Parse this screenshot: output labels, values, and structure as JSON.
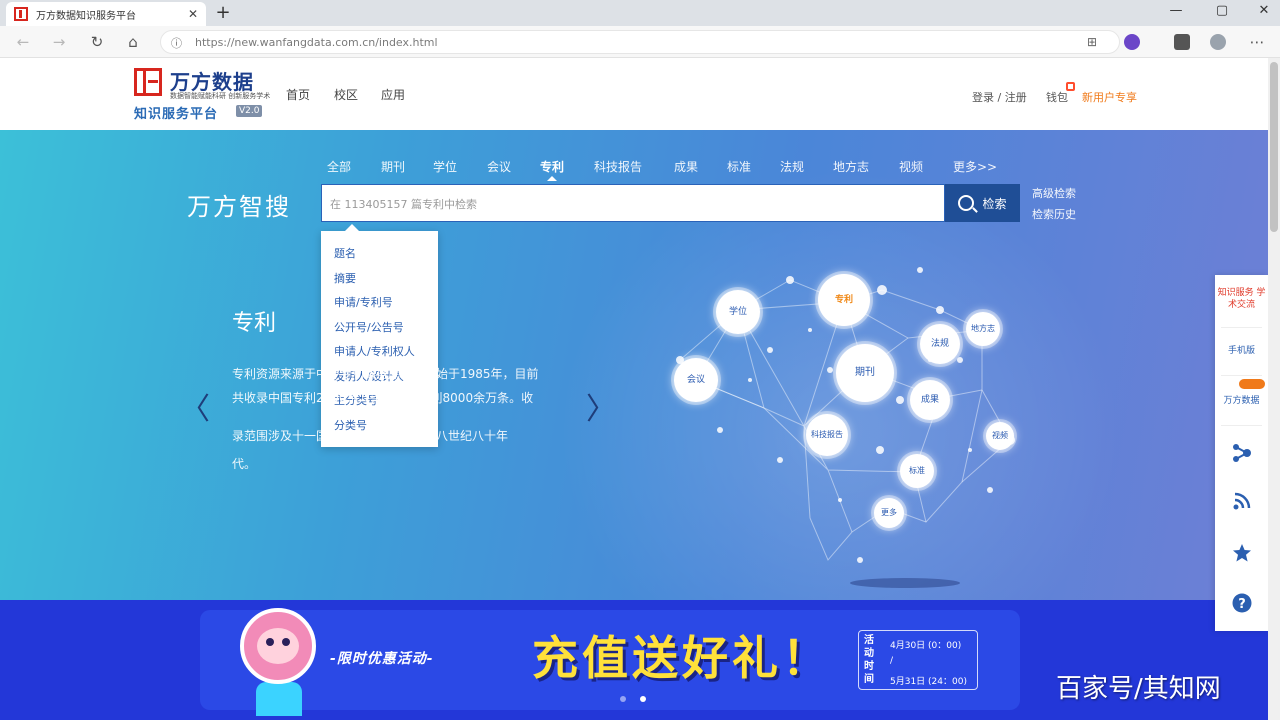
{
  "browser": {
    "tab_title": "万方数据知识服务平台",
    "tab_close": "✕",
    "new_tab": "+",
    "url": "https://new.wanfangdata.com.cn/index.html",
    "controls": {
      "minimize": "—",
      "maximize": "▢",
      "close": "✕"
    }
  },
  "header": {
    "logo_name": "万方数据",
    "logo_tagline": "数据智能赋能科研 创新服务学术",
    "logo_subtitle": "知识服务平台",
    "logo_version": "V2.0",
    "nav": [
      "首页",
      "校区",
      "应用"
    ],
    "login": "登录 / 注册",
    "cart": "钱包",
    "new_user": "新用户专享"
  },
  "search": {
    "categories": [
      "全部",
      "期刊",
      "学位",
      "会议",
      "专利",
      "科技报告",
      "成果",
      "标准",
      "法规",
      "地方志",
      "视频",
      "更多>>"
    ],
    "active_category": "专利",
    "brand": "万方智搜",
    "placeholder": "在 113405157 篇专利中检索",
    "button_label": "检索",
    "advanced": "高级检索",
    "history": "检索历史",
    "dropdown": [
      "题名",
      "摘要",
      "申请/专利号",
      "公开号/公告号",
      "申请人/专利权人",
      "发明人/设计人",
      "主分类号",
      "分类号"
    ]
  },
  "feature": {
    "title": "专利",
    "description_lines": [
      "专利资源来源于中外专利数据库，收录始于1985年，目前",
      "共收录中国专利2200余万条，国外专利8000余万条。收",
      "录范围涉及十一国两组织，内容涵盖十八世纪八十年",
      "代。"
    ],
    "prev": "〈",
    "next": "〉"
  },
  "brain_nodes": [
    "学位",
    "专利",
    "会议",
    "期刊",
    "法规",
    "地方志",
    "成果",
    "科技报告",
    "视频",
    "标准",
    "更多"
  ],
  "banner": {
    "tag": "-限时优惠活动-",
    "title": "充值送好礼！",
    "period_label": "活动时间",
    "date_start": "4月30日 (0：00)",
    "date_sep": "/",
    "date_end": "5月31日 (24：00)"
  },
  "float_bar": {
    "item1": "知识服务 学术交流",
    "item2": "手机版",
    "item3": "万方数据"
  },
  "watermark": "百家号/其知网",
  "colors": {
    "brand_red": "#d7261e",
    "brand_blue": "#1d3f8c",
    "search_button": "#1f4e96",
    "banner_bg": "#2337d8",
    "promo_yellow": "#ffe13a",
    "accent_orange": "#f07a1a"
  }
}
